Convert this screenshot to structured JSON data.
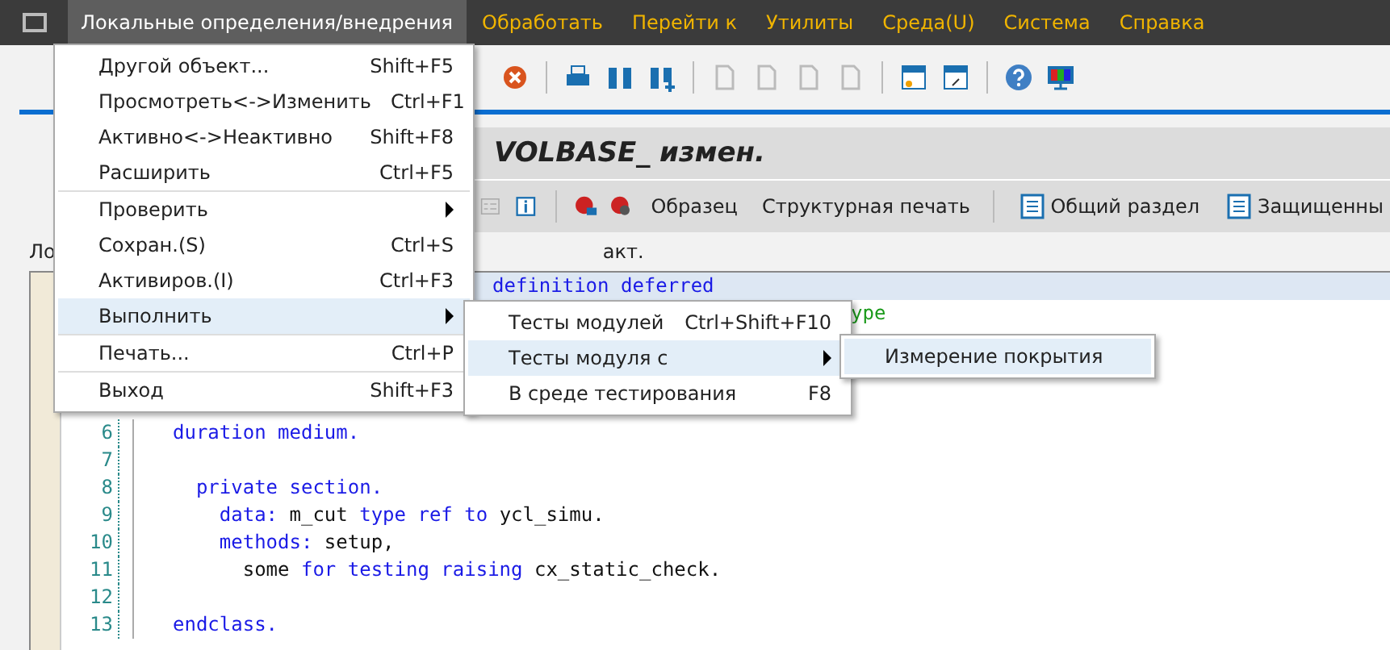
{
  "menubar": {
    "items": [
      {
        "label": "Локальные определения/внедрения",
        "selected": true
      },
      {
        "label": "Обработать",
        "selected": false
      },
      {
        "label": "Перейти к",
        "selected": false
      },
      {
        "label": "Утилиты",
        "selected": false
      },
      {
        "label": "Среда(U)",
        "selected": false
      },
      {
        "label": "Система",
        "selected": false
      },
      {
        "label": "Справка",
        "selected": false
      }
    ]
  },
  "title": "VOLBASE_ измен.",
  "app_toolbar": {
    "buttons": [
      "Образец",
      "Структурная печать",
      "Общий раздел",
      "Защищенны"
    ]
  },
  "header": {
    "column_1": "Ло",
    "column_2": "акт."
  },
  "editor": {
    "lines": [
      {
        "tokens": [
          {
            "text": "definition deferred",
            "kind": "keyword"
          }
        ],
        "selected": true
      },
      {
        "tokens": [
          {
            "text": "ype",
            "kind": "comment"
          }
        ],
        "selected": false
      },
      {
        "number": "6",
        "tokens": [
          {
            "text": "duration medium.",
            "kind": "keyword"
          }
        ],
        "selected": false
      },
      {
        "number": "7",
        "selected": false
      },
      {
        "number": "8",
        "tokens": [
          {
            "text": "  private section.",
            "kind": "keyword"
          }
        ],
        "selected": false
      },
      {
        "number": "9",
        "tokens": [
          {
            "text": "    data: ",
            "kind": "keyword"
          },
          {
            "text": "m_cut ",
            "kind": "plain"
          },
          {
            "text": "type ref to ",
            "kind": "keyword"
          },
          {
            "text": "ycl_simu.",
            "kind": "plain"
          }
        ],
        "selected": false
      },
      {
        "number": "10",
        "tokens": [
          {
            "text": "    methods: ",
            "kind": "keyword"
          },
          {
            "text": "setup,",
            "kind": "plain"
          }
        ],
        "selected": false
      },
      {
        "number": "11",
        "tokens": [
          {
            "text": "      some ",
            "kind": "plain"
          },
          {
            "text": "for testing raising ",
            "kind": "keyword"
          },
          {
            "text": "cx_static_check.",
            "kind": "plain"
          }
        ],
        "selected": false
      },
      {
        "number": "12",
        "selected": false
      },
      {
        "number": "13",
        "tokens": [
          {
            "text": "endclass.",
            "kind": "keyword"
          }
        ],
        "selected": false
      }
    ]
  },
  "menu": {
    "items": [
      {
        "label": "Другой объект...",
        "shortcut": "Shift+F5",
        "submenu": false,
        "selected": false,
        "separator_before": false
      },
      {
        "label": "Просмотреть<->Изменить",
        "shortcut": "Ctrl+F1",
        "submenu": false,
        "selected": false,
        "separator_before": false
      },
      {
        "label": "Активно<->Неактивно",
        "shortcut": "Shift+F8",
        "submenu": false,
        "selected": false,
        "separator_before": false
      },
      {
        "label": "Расширить",
        "shortcut": "Ctrl+F5",
        "submenu": false,
        "selected": false,
        "separator_before": false
      },
      {
        "label": "Проверить",
        "submenu": true,
        "selected": false,
        "separator_before": true
      },
      {
        "label": "Сохран.(S)",
        "shortcut": "Ctrl+S",
        "submenu": false,
        "selected": false,
        "separator_before": false
      },
      {
        "label": "Активиров.(I)",
        "shortcut": "Ctrl+F3",
        "submenu": false,
        "selected": false,
        "separator_before": false
      },
      {
        "label": "Выполнить",
        "submenu": true,
        "selected": true,
        "separator_before": false
      },
      {
        "label": "Печать...",
        "shortcut": "Ctrl+P",
        "submenu": false,
        "selected": false,
        "separator_before": true
      },
      {
        "label": "Выход",
        "shortcut": "Shift+F3",
        "submenu": false,
        "selected": false,
        "separator_before": true
      }
    ]
  },
  "submenu": {
    "items": [
      {
        "label": "Тесты модулей",
        "shortcut": "Ctrl+Shift+F10",
        "submenu": false,
        "selected": false
      },
      {
        "label": "Тесты модуля с",
        "submenu": true,
        "selected": true
      },
      {
        "label": "В среде тестирования",
        "shortcut": "F8",
        "submenu": false,
        "selected": false
      }
    ]
  },
  "submenu_2": {
    "items": [
      {
        "label": "Измерение покрытия",
        "submenu": false,
        "selected": true
      }
    ]
  }
}
